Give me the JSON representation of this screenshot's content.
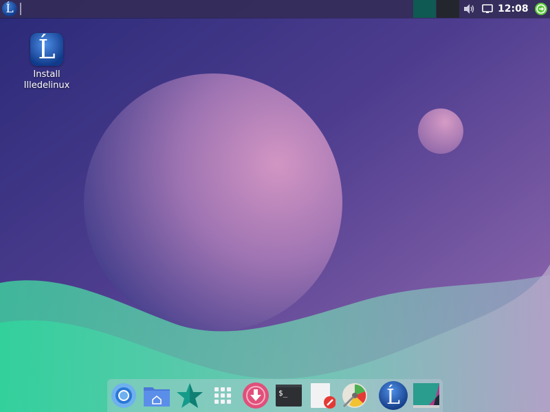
{
  "panel": {
    "start_icon_glyph": "Ĺ",
    "clock": "12:08",
    "workspaces": [
      "workspace-1",
      "workspace-2"
    ],
    "tray_icons": [
      "volume-icon",
      "display-icon",
      "logout-icon"
    ]
  },
  "desktop": {
    "icons": [
      {
        "label": "Install\nIlledelinux",
        "glyph": "Ĺ",
        "icon": "illedelinux-installer-icon"
      }
    ]
  },
  "dock": {
    "items": [
      {
        "icon": "chromium-icon"
      },
      {
        "icon": "home-folder-icon"
      },
      {
        "icon": "star-icon"
      },
      {
        "icon": "app-grid-icon"
      },
      {
        "icon": "download-icon"
      },
      {
        "icon": "terminal-icon",
        "text": "$_"
      },
      {
        "icon": "text-editor-icon"
      },
      {
        "icon": "disk-utility-icon"
      },
      {
        "icon": "illedelinux-icon",
        "glyph": "Ĺ"
      },
      {
        "icon": "screenshot-icon"
      }
    ]
  },
  "colors": {
    "panel": "#342c58",
    "accent_green": "#3ddc97",
    "workspace_active": "#0f5a52"
  }
}
